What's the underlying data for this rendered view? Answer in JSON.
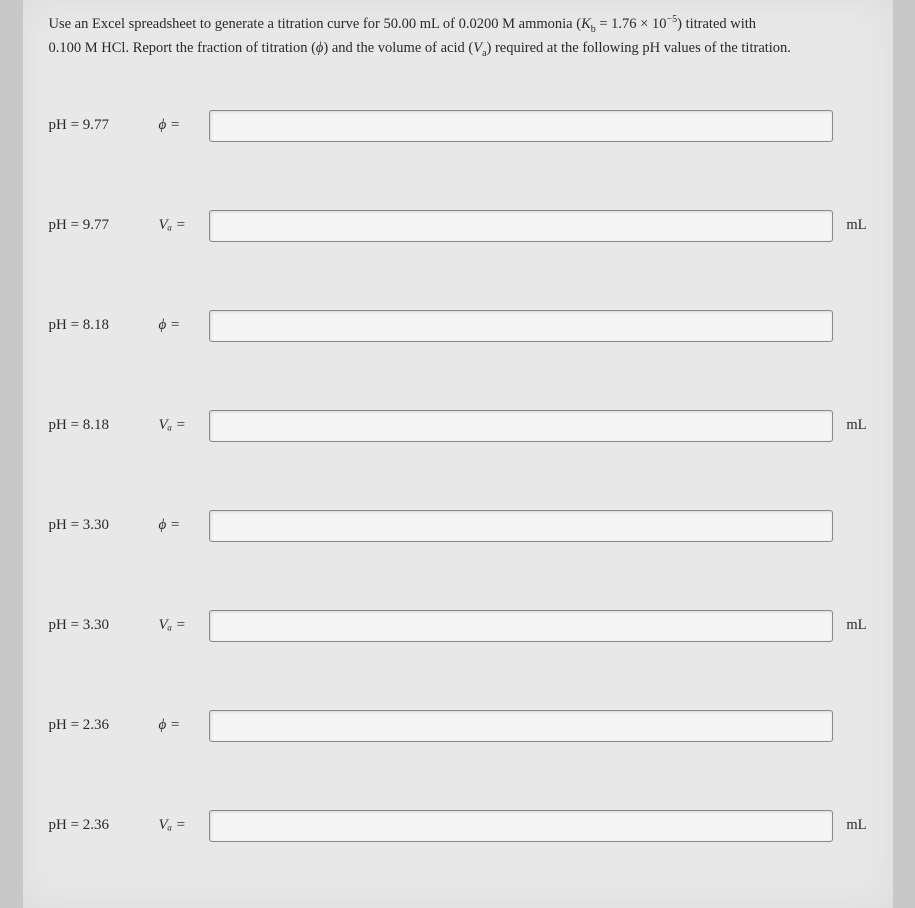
{
  "problem": {
    "line1_pre": "Use an Excel spreadsheet to generate a titration curve for 50.00 mL of 0.0200 M ammonia (",
    "kb_sym": "K",
    "kb_sub": "b",
    "eq": " = 1.76 × 10",
    "kb_exp": "−5",
    "line1_post": ") titrated with",
    "line2_pre": "0.100 M HCl. Report the fraction of titration (",
    "phi": "ϕ",
    "line2_mid": ") and the volume of acid (",
    "va_sym": "V",
    "va_sub": "a",
    "line2_post": ") required at the following pH values of the titration."
  },
  "rows": [
    {
      "ph": "pH = 9.77",
      "sym": "ϕ =",
      "unit": ""
    },
    {
      "ph": "pH = 9.77",
      "sym": "Vₐ =",
      "unit": "mL"
    },
    {
      "ph": "pH = 8.18",
      "sym": "ϕ =",
      "unit": ""
    },
    {
      "ph": "pH = 8.18",
      "sym": "Vₐ =",
      "unit": "mL"
    },
    {
      "ph": "pH = 3.30",
      "sym": "ϕ =",
      "unit": ""
    },
    {
      "ph": "pH = 3.30",
      "sym": "Vₐ =",
      "unit": "mL"
    },
    {
      "ph": "pH = 2.36",
      "sym": "ϕ =",
      "unit": ""
    },
    {
      "ph": "pH = 2.36",
      "sym": "Vₐ =",
      "unit": "mL"
    }
  ]
}
